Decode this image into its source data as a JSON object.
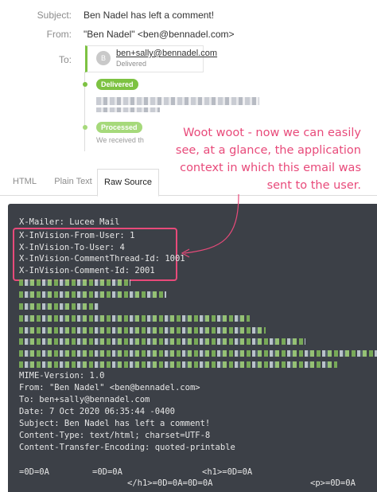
{
  "header": {
    "subject_label": "Subject:",
    "subject_value": "Ben Nadel has left a comment!",
    "from_label": "From:",
    "from_value": "\"Ben Nadel\" <ben@bennadel.com>",
    "to_label": "To:"
  },
  "recipient": {
    "avatar_letter": "B",
    "email": "ben+sally@bennadel.com",
    "status": "Delivered"
  },
  "timeline": {
    "delivered": "Delivered",
    "processed": "Processed",
    "received_text": "We received th"
  },
  "annotation": {
    "line1": "Woot woot - now we can easily",
    "line2": "see, at a glance, the application",
    "line3": "context in which this email was",
    "line4": "sent to the user."
  },
  "tabs": [
    {
      "label": "HTML"
    },
    {
      "label": "Plain Text"
    },
    {
      "label": "Raw Source"
    }
  ],
  "source": {
    "mailer_key": "X-Mailer:",
    "mailer_val": "Lucee Mail",
    "from_user_key": "X-InVision-From-User:",
    "from_user_val": "1",
    "to_user_key": "X-InVision-To-User:",
    "to_user_val": "4",
    "thread_key": "X-InVision-CommentThread-Id:",
    "thread_val": "1001",
    "comment_key": "X-InVision-Comment-Id:",
    "comment_val": "2001",
    "mime_key": "MIME-Version:",
    "mime_val": "1.0",
    "from_key": "From:",
    "from_val": "\"Ben Nadel\" <ben@bennadel.com>",
    "to_key": "To:",
    "to_val": "ben+sally@bennadel.com",
    "date_key": "Date:",
    "date_val": "7 Oct 2020 06:35:44 -0400",
    "subject_key": "Subject:",
    "subject_val": "Ben Nadel has left a comment!",
    "ctype_key": "Content-Type:",
    "ctype_val": "text/html; charset=UTF-8",
    "cte_key": "Content-Transfer-Encoding:",
    "cte_val": "quoted-printable",
    "body1a": "=0D=0A",
    "body1b": "=0D=0A",
    "body1c": "<h1>=0D=0A",
    "body2a": "</h1>=0D=0A=0D=0A",
    "body2b": "<p>=0D=0A"
  },
  "colors": {
    "accent_pink": "#e84a7a",
    "green": "#7dc242",
    "code_bg": "#3c4047"
  }
}
